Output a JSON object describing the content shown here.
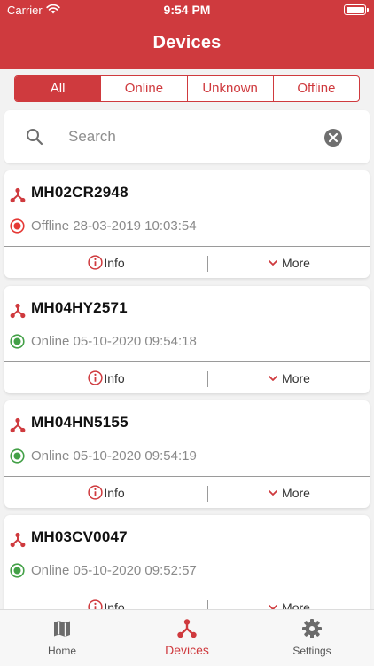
{
  "status_bar": {
    "carrier": "Carrier",
    "time": "9:54 PM"
  },
  "header": {
    "title": "Devices"
  },
  "filters": [
    {
      "label": "All",
      "active": true
    },
    {
      "label": "Online",
      "active": false
    },
    {
      "label": "Unknown",
      "active": false
    },
    {
      "label": "Offline",
      "active": false
    }
  ],
  "search": {
    "placeholder": "Search",
    "value": ""
  },
  "devices": [
    {
      "name": "MH02CR2948",
      "status": "Offline",
      "timestamp": "28-03-2019 10:03:54",
      "status_color": "#e53935"
    },
    {
      "name": "MH04HY2571",
      "status": "Online",
      "timestamp": "05-10-2020 09:54:18",
      "status_color": "#43a047"
    },
    {
      "name": "MH04HN5155",
      "status": "Online",
      "timestamp": "05-10-2020 09:54:19",
      "status_color": "#43a047"
    },
    {
      "name": "MH03CV0047",
      "status": "Online",
      "timestamp": "05-10-2020 09:52:57",
      "status_color": "#43a047"
    }
  ],
  "card_actions": {
    "info_label": "Info",
    "more_label": "More"
  },
  "tabs": [
    {
      "label": "Home",
      "icon": "map-icon",
      "active": false
    },
    {
      "label": "Devices",
      "icon": "devices-icon",
      "active": true
    },
    {
      "label": "Settings",
      "icon": "gear-icon",
      "active": false
    }
  ],
  "colors": {
    "brand": "#cf3a3e",
    "offline": "#e53935",
    "online": "#43a047"
  }
}
